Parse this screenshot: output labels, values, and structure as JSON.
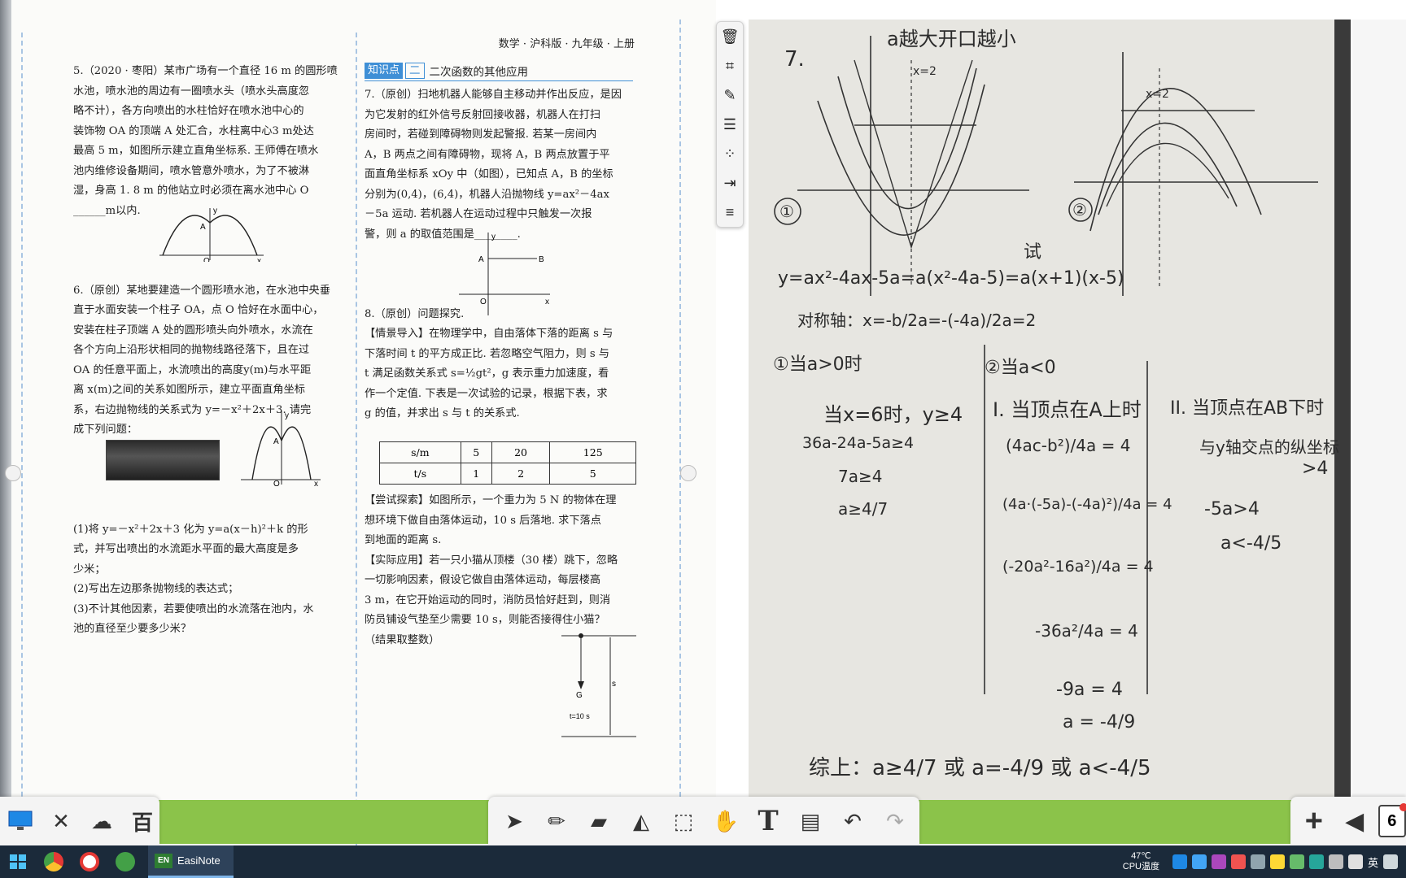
{
  "book": {
    "header": "数学 · 沪科版 · 九年级 · 上册",
    "section": {
      "tag": "知识点",
      "num": "二",
      "title": "二次函数的其他应用"
    },
    "left_col": [
      "5.（2020 · 枣阳）某市广场有一个直径 16 m 的圆形喷",
      "水池，喷水池的周边有一圈喷水头（喷水头高度忽",
      "略不计），各方向喷出的水柱恰好在喷水池中心的",
      "装饰物 OA 的顶端 A 处汇合，水柱离中心3 m处达",
      "最高 5 m，如图所示建立直角坐标系. 王师傅在喷水",
      "池内维修设备期间，喷水管意外喷水，为了不被淋",
      "湿，身高 1. 8 m 的他站立时必须在离水池中心 O",
      "______m以内.",
      "",
      "",
      "",
      "6.（原创）某地要建造一个圆形喷水池，在水池中央垂",
      "直于水面安装一个柱子 OA，点 O 恰好在水面中心，",
      "安装在柱子顶端 A 处的圆形喷头向外喷水，水流在",
      "各个方向上沿形状相同的抛物线路径落下，且在过",
      "OA 的任意平面上，水流喷出的高度y(m)与水平距",
      "离 x(m)之间的关系如图所示，建立平面直角坐标",
      "系，右边抛物线的关系式为 y=－x²＋2x＋3. 请完",
      "成下列问题：",
      "",
      "",
      "",
      "",
      "(1)将 y=－x²＋2x＋3 化为 y=a(x－h)²＋k 的形",
      "式，并写出喷出的水流距水平面的最大高度是多",
      "少米；",
      "(2)写出左边那条抛物线的表达式；",
      "(3)不计其他因素，若要使喷出的水流落在池内，水",
      "池的直径至少要多少米？"
    ],
    "right_col": [
      "7.（原创）扫地机器人能够自主移动并作出反应，是因",
      "为它发射的红外信号反射回接收器，机器人在打扫",
      "房间时，若碰到障碍物则发起警报. 若某一房间内",
      "A，B 两点之间有障碍物，现将 A，B 两点放置于平",
      "面直角坐标系 xOy 中（如图），已知点 A，B 的坐标",
      "分别为(0,4)，(6,4)，机器人沿抛物线 y=ax²－4ax",
      "－5a 运动. 若机器人在运动过程中只触发一次报",
      "警，则 a 的取值范围是________.",
      "",
      "",
      "",
      "8.（原创）问题探究.",
      "【情景导入】在物理学中，自由落体下落的距离 s 与",
      "下落时间 t 的平方成正比. 若忽略空气阻力，则 s 与",
      "t 满足函数关系式 s=½gt²，g 表示重力加速度，看",
      "作一个定值. 下表是一次试验的记录，根据下表，求",
      "g 的值，并求出 s 与 t 的关系式."
    ],
    "right_col_after": [
      "【尝试探索】如图所示，一个重力为 5 N 的物体在理",
      "想环境下做自由落体运动，10 s 后落地. 求下落点",
      "到地面的距离 s.",
      "【实际应用】若一只小猫从顶楼（30 楼）跳下，忽略",
      "一切影响因素，假设它做自由落体运动，每层楼高",
      "3 m，在它开始运动的同时，消防员恰好赶到，则消",
      "防员铺设气垫至少需要 10 s，则能否接得住小猫？",
      "（结果取整数）"
    ],
    "table": {
      "row1": [
        "s/m",
        "5",
        "20",
        "125"
      ],
      "row2": [
        "t/s",
        "1",
        "2",
        "5"
      ]
    },
    "fig_labels": {
      "A": "A",
      "B": "B",
      "O": "O",
      "x": "x",
      "y": "y",
      "G": "G",
      "s": "s",
      "t10": "t=10 s"
    }
  },
  "handwriting": {
    "top_note": "a越大开口越小",
    "num7": "7.",
    "x2_left": "x=2",
    "x2_right": "x=2",
    "circle1": "①",
    "circle2": "②",
    "try_note": "试",
    "eq_main": "y=ax²-4ax-5a=a(x²-4a-5)=a(x+1)(x-5)",
    "axis_sym": "对称轴：x=-b/2a=-(-4a)/2a=2",
    "case1": "①当a>0时",
    "case2": "②当a<0",
    "case1_cond": "当x=6时，y≥4",
    "case1_l1": "36a-24a-5a≥4",
    "case1_l2": "7a≥4",
    "case1_l3": "a≥4/7",
    "case2_I": "I. 当顶点在A上时",
    "case2_II": "II. 当顶点在AB下时",
    "case2_II_note": "与y轴交点的纵坐标",
    "case2_II_gt4": ">4",
    "case2_II_l1": "-5a>4",
    "case2_II_l2": "a<-4/5",
    "step1": "(4ac-b²)/4a = 4",
    "step2": "(4a·(-5a)-(-4a)²)/4a = 4",
    "step3": "(-20a²-16a²)/4a = 4",
    "step4": "-36a²/4a = 4",
    "step5": "-9a = 4",
    "step6": "a = -4/9",
    "summary": "综上：a≥4/7 或 a=-4/9 或 a<-4/5"
  },
  "toolbar": {
    "left": [
      "desktop-icon",
      "tools-icon",
      "cloud-icon",
      "hundred-icon"
    ],
    "mid": [
      "select-icon",
      "pen-icon",
      "eraser-icon",
      "shape-icon",
      "cube-icon",
      "hand-icon",
      "text-icon",
      "note-icon",
      "undo-icon",
      "redo-icon"
    ],
    "text_tool": "T",
    "page_count": "6"
  },
  "vtools": [
    "delete-icon",
    "crop-icon",
    "edit-image-icon",
    "align-icon",
    "dots-icon",
    "export-icon",
    "menu-icon"
  ],
  "taskbar": {
    "app_badge": "EN",
    "app_label": "EasiNote",
    "temp_value": "47℃",
    "temp_label": "CPU温度",
    "ime": "英",
    "colors": {
      "bar": "#1b2a3a",
      "accent": "#8bc34a"
    }
  }
}
